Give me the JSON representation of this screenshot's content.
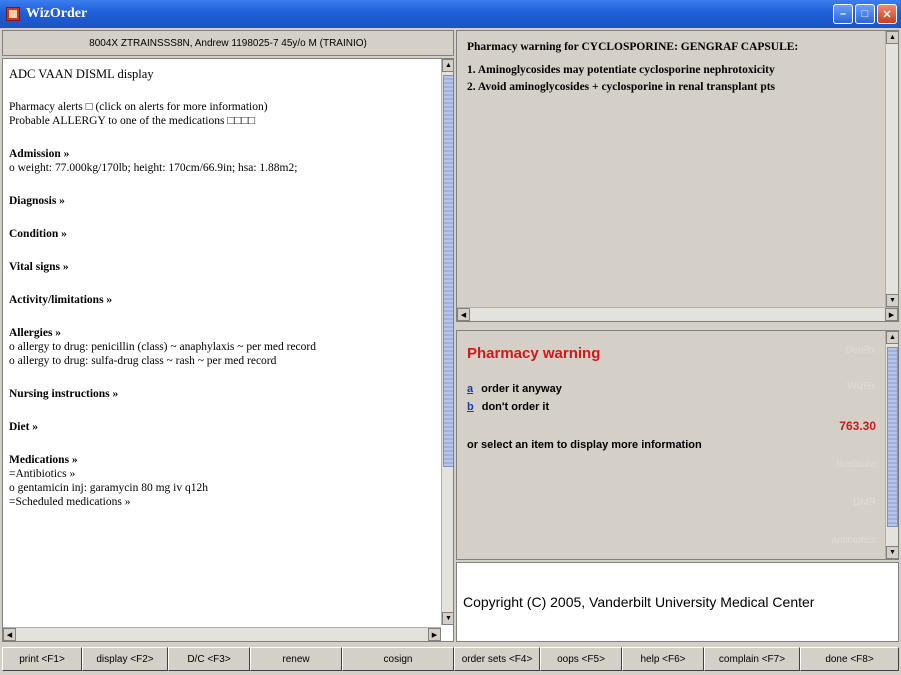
{
  "window": {
    "title": "WizOrder"
  },
  "patient_header": "8004X ZTRAINSSS8N, Andrew 1198025-7 45y/o M (TRAINIO)",
  "left_lines": [
    {
      "text": "ADC VAAN DISML display",
      "style": "big"
    },
    {
      "text": "",
      "style": "gap"
    },
    {
      "text": "Pharmacy alerts □ (click on alerts for more information)",
      "style": ""
    },
    {
      "text": "  Probable ALLERGY to one of the medications □□□□",
      "style": ""
    },
    {
      "text": "",
      "style": "gap"
    },
    {
      "text": "Admission »",
      "style": "bold"
    },
    {
      "text": "o weight: 77.000kg/170lb;  height: 170cm/66.9in;  hsa: 1.88m2;",
      "style": ""
    },
    {
      "text": "",
      "style": "gap"
    },
    {
      "text": "Diagnosis »",
      "style": "bold"
    },
    {
      "text": "",
      "style": "gap"
    },
    {
      "text": "Condition »",
      "style": "bold"
    },
    {
      "text": "",
      "style": "gap"
    },
    {
      "text": "Vital signs »",
      "style": "bold"
    },
    {
      "text": "",
      "style": "gap"
    },
    {
      "text": "Activity/limitations »",
      "style": "bold"
    },
    {
      "text": "",
      "style": "gap"
    },
    {
      "text": "Allergies »",
      "style": "bold"
    },
    {
      "text": "o allergy to drug:  penicillin (class)  ~ anaphylaxis ~  per med record",
      "style": ""
    },
    {
      "text": "o allergy to drug:  sulfa-drug class  ~ rash ~  per med record",
      "style": ""
    },
    {
      "text": "",
      "style": "gap"
    },
    {
      "text": "Nursing instructions »",
      "style": "bold"
    },
    {
      "text": "",
      "style": "gap"
    },
    {
      "text": "Diet »",
      "style": "bold"
    },
    {
      "text": "",
      "style": "gap"
    },
    {
      "text": "Medications »",
      "style": "bold"
    },
    {
      "text": "=Antibiotics »",
      "style": ""
    },
    {
      "text": "o gentamicin inj:  garamycin  80 mg iv q12h",
      "style": ""
    },
    {
      "text": "=Scheduled medications »",
      "style": ""
    }
  ],
  "pharmacy_warning_panel": {
    "heading": "Pharmacy warning for CYCLOSPORINE: GENGRAF CAPSULE:",
    "lines": [
      "1. Aminoglycosides may potentiate cyclosporine nephrotoxicity",
      "2. Avoid aminoglycosides + cyclosporine in renal transplant pts"
    ]
  },
  "action_panel": {
    "title": "Pharmacy warning",
    "options": [
      {
        "key": "a",
        "label": "order it anyway"
      },
      {
        "key": "b",
        "label": "don't order it"
      }
    ],
    "hint": "or select an item to display more information",
    "side_links": [
      "DenRx",
      "WizRx",
      "literature",
      "DMR",
      "antibiotics"
    ],
    "price": "763.30"
  },
  "copyright": "Copyright (C) 2005, Vanderbilt University Medical Center",
  "function_buttons": [
    "print <F1>",
    "display <F2>",
    "D/C <F3>",
    "renew",
    "cosign",
    "order sets <F4>",
    "oops <F5>",
    "help <F6>",
    "complain <F7>",
    "done <F8>"
  ]
}
